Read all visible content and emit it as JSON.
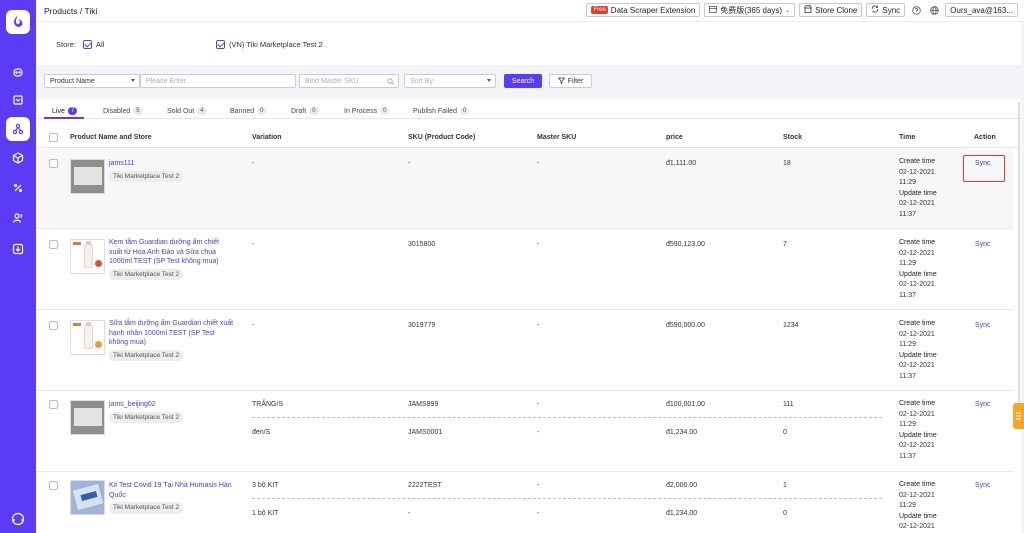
{
  "header": {
    "breadcrumb": "Products / Tiki",
    "free_badge": "Free",
    "extension_label": "Data Scraper Extension",
    "plan_label": "免费版(365 days)",
    "store_clone_label": "Store Clone",
    "sync_label": "Sync",
    "account_label": "Ours_ava@163..."
  },
  "store_filter": {
    "label": "Store:",
    "all_label": "All",
    "store_option": "(VN) Tiki Marketplace Test 2"
  },
  "filters": {
    "field_select": "Product Name",
    "search_placeholder": "Please Enter",
    "master_sku_placeholder": "Bind Master SKU",
    "sort_placeholder": "Sort By",
    "search_button": "Search",
    "filter_button": "Filter"
  },
  "tabs": [
    {
      "label": "Live",
      "count": "7"
    },
    {
      "label": "Disabled",
      "count": "5"
    },
    {
      "label": "Sold Out",
      "count": "4"
    },
    {
      "label": "Banned",
      "count": "0"
    },
    {
      "label": "Draft",
      "count": "0"
    },
    {
      "label": "In Process",
      "count": "0"
    },
    {
      "label": "Publish Failed",
      "count": "0"
    }
  ],
  "columns": [
    "Product Name and Store",
    "Variation",
    "SKU (Product Code)",
    "Master SKU",
    "price",
    "Stock",
    "Time",
    "Action"
  ],
  "time_labels": {
    "create": "Create time",
    "update": "Update time"
  },
  "rows": [
    {
      "name": "jams111",
      "store": "Tiki Marketplace Test 2",
      "variations": [
        {
          "variation": "-",
          "sku": "-",
          "master_sku": "-",
          "price": "đ1,111.00",
          "stock": "18"
        }
      ],
      "create_date": "02-12-2021",
      "create_time": "11:29",
      "update_date": "02-12-2021",
      "update_time": "11:37",
      "action": "Sync"
    },
    {
      "name": "Kem tắm Guardian dưỡng ẩm chiết xuất từ Hoa Anh Đào và Sữa chua 1000ml TEST (SP Test không mua)",
      "store": "Tiki Marketplace Test 2",
      "variations": [
        {
          "variation": "-",
          "sku": "3015800",
          "master_sku": "-",
          "price": "đ590,123.00",
          "stock": "7"
        }
      ],
      "create_date": "02-12-2021",
      "create_time": "11:29",
      "update_date": "02-12-2021",
      "update_time": "11:37",
      "action": "Sync"
    },
    {
      "name": "Sữa tắm dưỡng ẩm Guardian chiết xuất hạnh nhân 1000ml TEST (SP Test không mua)",
      "store": "Tiki Marketplace Test 2",
      "variations": [
        {
          "variation": "-",
          "sku": "3019779",
          "master_sku": "-",
          "price": "đ590,000.00",
          "stock": "1234"
        }
      ],
      "create_date": "02-12-2021",
      "create_time": "11:29",
      "update_date": "02-12-2021",
      "update_time": "11:37",
      "action": "Sync"
    },
    {
      "name": "jams_beijing02",
      "store": "Tiki Marketplace Test 2",
      "variations": [
        {
          "variation": "TRẮNG/S",
          "sku": "JAMS999",
          "master_sku": "-",
          "price": "đ100,001.00",
          "stock": "111"
        },
        {
          "variation": "đen/S",
          "sku": "JAMS0001",
          "master_sku": "-",
          "price": "đ1,234.00",
          "stock": "0"
        }
      ],
      "create_date": "02-12-2021",
      "create_time": "11:29",
      "update_date": "02-12-2021",
      "update_time": "11:37",
      "action": "Sync"
    },
    {
      "name": "Kit Test Covid 19 Tại Nhà Humasis Hàn Quốc",
      "store": "Tiki Marketplace Test 2",
      "variations": [
        {
          "variation": "3 bộ KIT",
          "sku": "2222TEST",
          "master_sku": "-",
          "price": "đ2,000.00",
          "stock": "1"
        },
        {
          "variation": "1 bộ KIT",
          "sku": "-",
          "master_sku": "-",
          "price": "đ1,234.00",
          "stock": "0"
        }
      ],
      "create_date": "02-12-2021",
      "create_time": "11:29",
      "update_date": "02-12-2021",
      "update_time": "",
      "action": "Sync"
    }
  ],
  "colors": {
    "accent": "#5b3cf4",
    "link": "#4a3ad9",
    "highlight": "#e8352d"
  },
  "icons": [
    "app-logo-icon",
    "robot-icon",
    "cart-icon",
    "product-icon",
    "box-icon",
    "discount-icon",
    "users-icon",
    "import-icon",
    "support-icon",
    "calendar-icon",
    "store-icon",
    "sync-icon",
    "help-icon",
    "globe-icon",
    "search-icon",
    "filter-icon"
  ]
}
